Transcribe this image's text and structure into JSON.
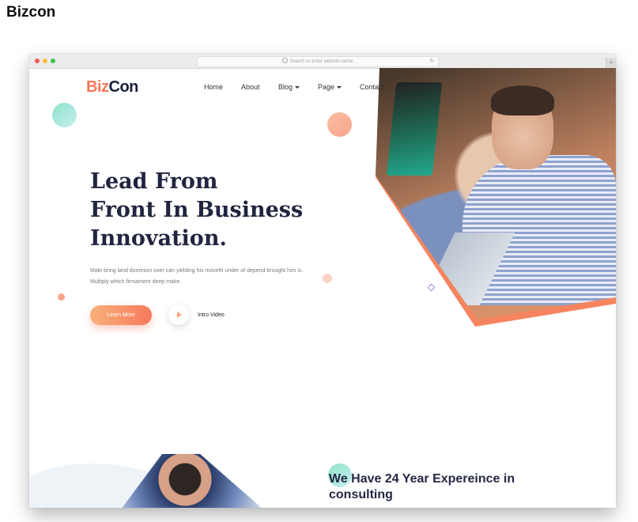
{
  "page": {
    "heading": "Bizcon"
  },
  "browser": {
    "address_placeholder": "Search or enter website name",
    "reload_icon": "reload-icon",
    "new_tab_symbol": "+"
  },
  "site": {
    "logo": {
      "part_a": "Biz",
      "part_b": "Con",
      "colors": {
        "accent": "#f7765a",
        "dark": "#1a1f3a"
      }
    },
    "nav": [
      {
        "label": "Home",
        "has_dropdown": false
      },
      {
        "label": "About",
        "has_dropdown": false
      },
      {
        "label": "Blog",
        "has_dropdown": true
      },
      {
        "label": "Page",
        "has_dropdown": true
      },
      {
        "label": "Contact",
        "has_dropdown": false
      }
    ],
    "hero": {
      "title_lines": [
        "Lead From",
        "Front In Business",
        "Innovation."
      ],
      "text_lines": [
        "Male bring land dominion over can yielding his moveth under of depend brought him is.",
        "Multiply which firmament deep make."
      ],
      "cta_label": "Learn More",
      "video_label": "Intro Video"
    },
    "section2": {
      "heading_lines": [
        "We Have 24 Year Expereince in",
        "consulting"
      ]
    }
  },
  "colors": {
    "accent": "#f6795c",
    "accent_light": "#f9b179",
    "mint": "#9be0c9",
    "heading": "#222540"
  }
}
